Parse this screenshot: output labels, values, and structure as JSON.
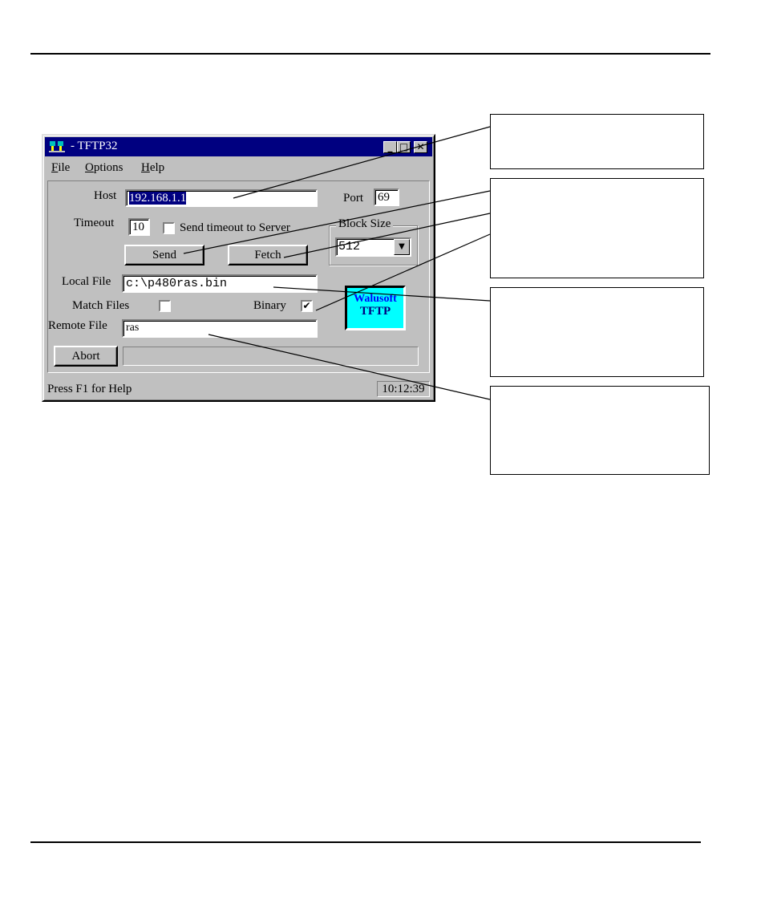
{
  "window": {
    "title": "- TFTP32",
    "menu": {
      "file": "F",
      "file_rest": "ile",
      "options": "O",
      "options_rest": "ptions",
      "help": "H",
      "help_rest": "elp"
    },
    "host_label": "Host",
    "host_value": "192.168.1.1",
    "port_label": "Port",
    "port_value": "69",
    "timeout_label": "Timeout",
    "timeout_value": "10",
    "send_timeout_label": "Send timeout to Server",
    "send_timeout_checked": false,
    "block_size_label": "Block Size",
    "block_size_value": "512",
    "send_button": "Send",
    "fetch_button": "Fetch",
    "local_file_label": "Local File",
    "local_file_value": "c:\\p480ras.bin",
    "match_files_label": "Match Files",
    "match_files_checked": false,
    "binary_label": "Binary",
    "binary_checked": true,
    "remote_file_label": "Remote File",
    "remote_file_value": "ras",
    "abort_button": "Abort",
    "logo_line1": "Walusoft",
    "logo_line2": "TFTP",
    "status_text": "Press F1 for Help",
    "clock": "10:12:39",
    "checkmark": "✔",
    "minimize": "_",
    "maximize": "□",
    "close": "✕",
    "dropdown_arrow": "▼"
  },
  "colors": {
    "titlebar": "#000080",
    "face": "#c0c0c0",
    "logo_bg": "#00ffff",
    "logo_text_1": "#0000ff",
    "logo_text_2": "#000080"
  }
}
